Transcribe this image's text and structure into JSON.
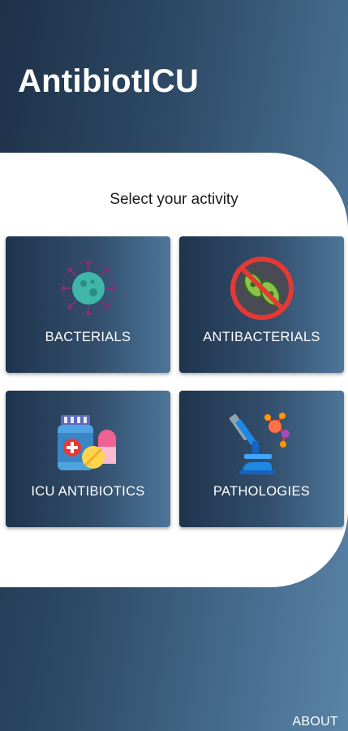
{
  "app": {
    "title": "AntibiotICU"
  },
  "main": {
    "subtitle": "Select your activity",
    "cards": [
      {
        "label": "BACTERIALS",
        "icon": "bacteria-icon"
      },
      {
        "label": "ANTIBACTERIALS",
        "icon": "no-bacteria-icon"
      },
      {
        "label": "ICU ANTIBIOTICS",
        "icon": "medicine-icon"
      },
      {
        "label": "PATHOLOGIES",
        "icon": "microscope-icon"
      }
    ]
  },
  "footer": {
    "about_label": "ABOUT"
  },
  "colors": {
    "background_dark": "#1d3148",
    "background_light": "#5a84a8",
    "panel": "#ffffff",
    "card_dark": "#1f344d",
    "card_light": "#4d7699"
  }
}
